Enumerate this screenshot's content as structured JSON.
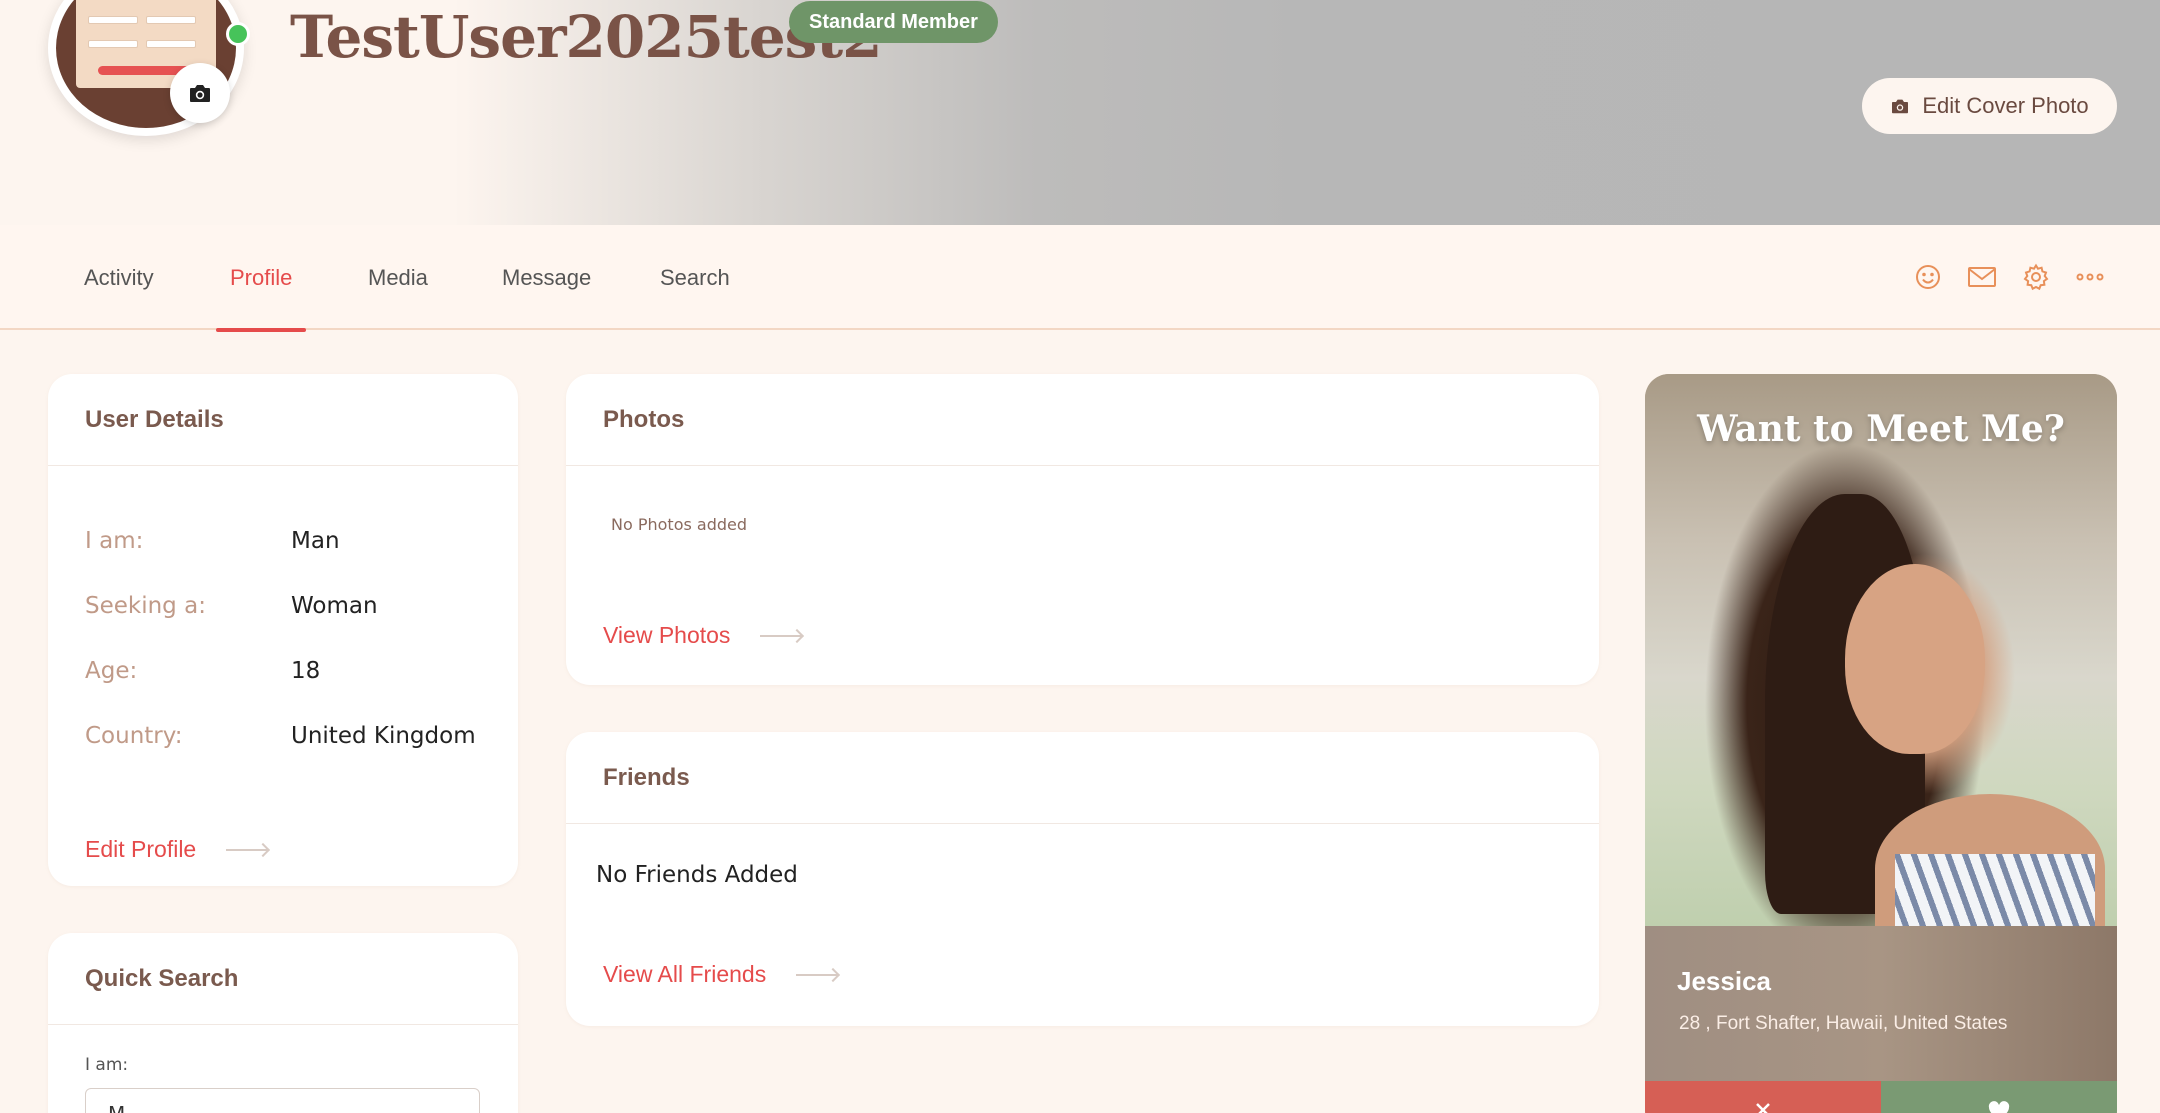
{
  "profile": {
    "username": "TestUser2025test2",
    "badge": "Standard Member",
    "edit_cover_label": "Edit Cover Photo"
  },
  "nav": {
    "tabs": [
      {
        "label": "Activity",
        "active": false
      },
      {
        "label": "Profile",
        "active": true
      },
      {
        "label": "Media",
        "active": false
      },
      {
        "label": "Message",
        "active": false
      },
      {
        "label": "Search",
        "active": false
      }
    ],
    "icons": [
      "smiley-icon",
      "mail-icon",
      "gear-icon",
      "more-icon"
    ],
    "accent": "#e54b4b",
    "icon_color": "#e8905a"
  },
  "user_details": {
    "title": "User Details",
    "rows": [
      {
        "label": "I am:",
        "value": "Man"
      },
      {
        "label": "Seeking a:",
        "value": "Woman"
      },
      {
        "label": "Age:",
        "value": "18"
      },
      {
        "label": "Country:",
        "value": "United Kingdom"
      }
    ],
    "edit_link": "Edit Profile"
  },
  "quick_search": {
    "title": "Quick Search",
    "i_am_label": "I am:",
    "i_am_value": "M"
  },
  "photos": {
    "title": "Photos",
    "empty": "No Photos added",
    "link": "View Photos"
  },
  "friends": {
    "title": "Friends",
    "empty": "No Friends Added",
    "link": "View All Friends"
  },
  "meet": {
    "title": "Want to Meet Me?",
    "name": "Jessica",
    "location": "28 , Fort Shafter, Hawaii, United States",
    "no_color": "#d65f55",
    "yes_color": "#7a9a73"
  }
}
